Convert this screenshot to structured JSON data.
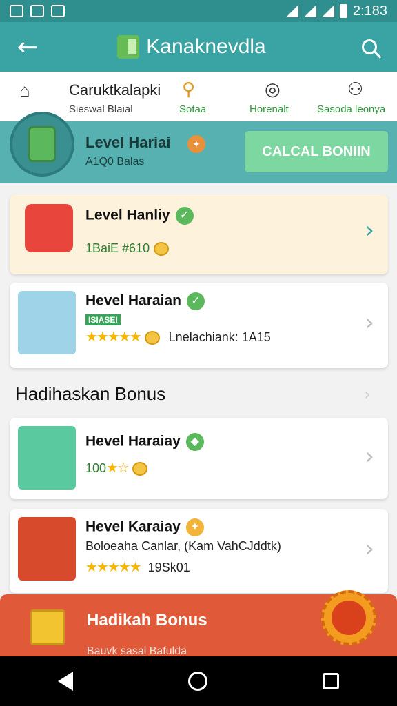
{
  "statusbar": {
    "time": "2:183",
    "icons": [
      "gallery-icon",
      "chat-icon",
      "image-icon"
    ]
  },
  "appbar": {
    "title": "Kanaknevdla"
  },
  "tabs": [
    {
      "icon": "home-icon",
      "title": "Caruktkalapki",
      "sub": "Sieswal Blaial",
      "sub_color": "#444444"
    },
    {
      "icon": "search-icon",
      "title": "",
      "sub": "Sotaa",
      "sub_color": "#2e9a3b"
    },
    {
      "icon": "notification-icon",
      "title": "",
      "sub": "Horenalt",
      "sub_color": "#2e9a3b"
    },
    {
      "icon": "user-icon",
      "title": "",
      "sub": "Sasoda leonya",
      "sub_color": "#2e9a3b"
    }
  ],
  "banner": {
    "title": "Level Hariai",
    "subtitle": "A1Q0 Balas",
    "button": "CALCAL BONIIN"
  },
  "cards": [
    {
      "title": "Level Hanliy",
      "line": "1BaiE #610",
      "highlight": true
    },
    {
      "title": "Hevel Haraian",
      "tag": "ISIASEI",
      "stars": "★★★★★",
      "line": "Lnelachiank: 1A15"
    },
    {
      "title": "Hevel Haraiay",
      "line": "100",
      "stars": "★☆"
    },
    {
      "title": "Hevel Karaiay",
      "line": "Boloeaha Canlar, (Kam VahCJddtk)",
      "stars": "★★★★★",
      "line2": "19Sk01"
    }
  ],
  "section": {
    "title": "Hadihaskan Bonus"
  },
  "bonus": {
    "title": "Hadikah Bonus",
    "subtitle": "Bauvk sasal Bafulda"
  },
  "colors": {
    "teal": "#3aa3a3",
    "accent_green": "#7dd7a1",
    "orange_red": "#e05a3a"
  }
}
